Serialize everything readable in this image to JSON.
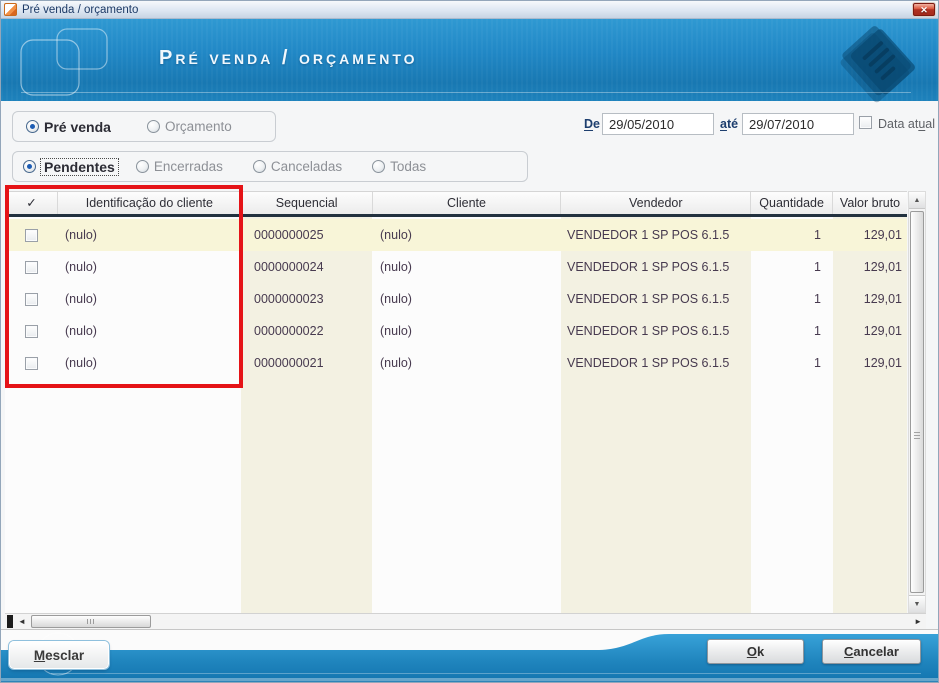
{
  "window": {
    "title": "Pré venda / orçamento"
  },
  "header": {
    "title": "Pré venda / orçamento"
  },
  "icons": {
    "close": "✕",
    "scroll_up": "▲",
    "scroll_down": "▼",
    "scroll_left": "◄",
    "scroll_right": "►"
  },
  "filters": {
    "type_options": [
      {
        "label": "Pré venda",
        "selected": true
      },
      {
        "label": "Orçamento",
        "selected": false
      }
    ],
    "status_options": [
      {
        "label": "Pendentes",
        "selected": true
      },
      {
        "label": "Encerradas",
        "selected": false
      },
      {
        "label": "Canceladas",
        "selected": false
      },
      {
        "label": "Todas",
        "selected": false
      }
    ],
    "date_from": {
      "label_accel": "D",
      "label_rest": "e",
      "value": "29/05/2010"
    },
    "date_to": {
      "label_accel": "a",
      "label_rest": "té",
      "value": "29/07/2010"
    },
    "data_atual": {
      "label_pre": "Data at",
      "label_accel": "u",
      "label_post": "al",
      "checked": false
    }
  },
  "grid": {
    "header": {
      "check": "✓",
      "identificacao": "Identificação do cliente",
      "sequencial": "Sequencial",
      "cliente": "Cliente",
      "vendedor": "Vendedor",
      "quantidade": "Quantidade",
      "valor_bruto": "Valor bruto"
    },
    "rows": [
      {
        "checked": false,
        "identificacao": "(nulo)",
        "sequencial": "0000000025",
        "cliente": "(nulo)",
        "vendedor": "VENDEDOR 1 SP POS 6.1.5",
        "quantidade": "1",
        "valor_bruto": "129,01"
      },
      {
        "checked": false,
        "identificacao": "(nulo)",
        "sequencial": "0000000024",
        "cliente": "(nulo)",
        "vendedor": "VENDEDOR 1 SP POS 6.1.5",
        "quantidade": "1",
        "valor_bruto": "129,01"
      },
      {
        "checked": false,
        "identificacao": "(nulo)",
        "sequencial": "0000000023",
        "cliente": "(nulo)",
        "vendedor": "VENDEDOR 1 SP POS 6.1.5",
        "quantidade": "1",
        "valor_bruto": "129,01"
      },
      {
        "checked": false,
        "identificacao": "(nulo)",
        "sequencial": "0000000022",
        "cliente": "(nulo)",
        "vendedor": "VENDEDOR 1 SP POS 6.1.5",
        "quantidade": "1",
        "valor_bruto": "129,01"
      },
      {
        "checked": false,
        "identificacao": "(nulo)",
        "sequencial": "0000000021",
        "cliente": "(nulo)",
        "vendedor": "VENDEDOR 1 SP POS 6.1.5",
        "quantidade": "1",
        "valor_bruto": "129,01"
      }
    ]
  },
  "buttons": {
    "mesclar": {
      "accel": "M",
      "rest": "esclar"
    },
    "ok": {
      "accel": "O",
      "rest": "k"
    },
    "cancelar": {
      "accel": "C",
      "rest": "ancelar"
    }
  },
  "colors": {
    "header_blue": "#1e83c2",
    "footer_blue": "#1878b2",
    "annotation_red": "#e51317",
    "row_highlight": "#f8f5d8",
    "column_stripe": "#f3f1e2",
    "header_underline": "#22313f"
  }
}
